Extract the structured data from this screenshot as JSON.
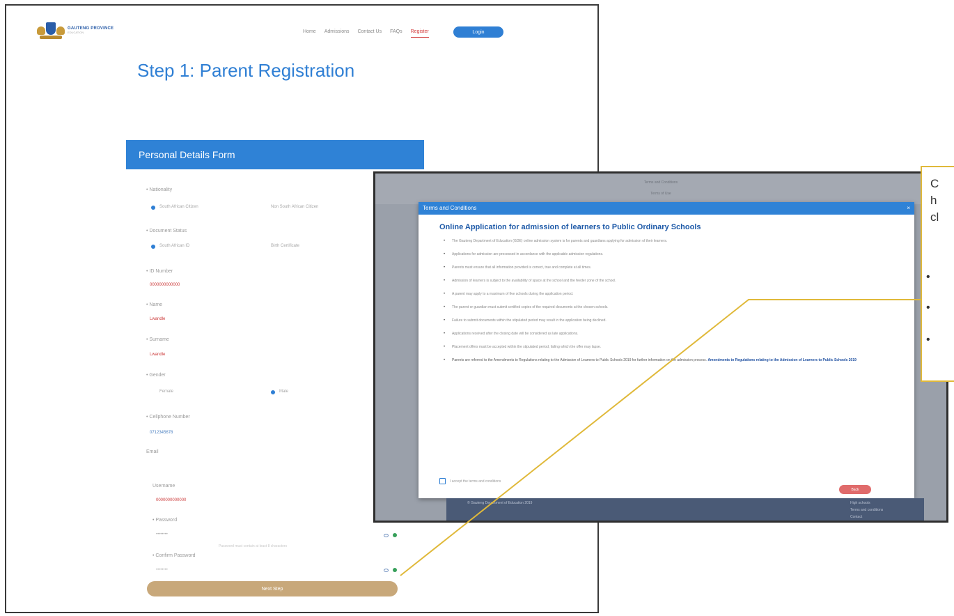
{
  "nav": {
    "brand": "GAUTENG PROVINCE",
    "brand_sub": "EDUCATION",
    "items": [
      "Home",
      "Admissions",
      "Contact Us",
      "FAQs",
      "Register"
    ],
    "login": "Login"
  },
  "page": {
    "step_prefix": "Step 1:",
    "step_title": "Parent Registration",
    "form_title": "Personal Details Form"
  },
  "form": {
    "fields": [
      {
        "label": "• Nationality",
        "value": ""
      },
      {
        "label": "• Document Status",
        "value": ""
      },
      {
        "label": "• ID Number",
        "value": "0000000000000"
      },
      {
        "label": "• Name",
        "value": "Lwandle"
      },
      {
        "label": "• Surname",
        "value": "Lwandle"
      },
      {
        "label": "• Gender",
        "value": ""
      },
      {
        "label": "• Cellphone Number",
        "value": "0712345678"
      },
      {
        "label": "Email",
        "value": ""
      },
      {
        "label": "Username",
        "value": "0000000000000"
      },
      {
        "label": "• Password",
        "value": "••••••••"
      },
      {
        "label": "• Confirm Password",
        "value": "••••••••"
      }
    ],
    "radios": {
      "nationality": [
        "South African Citizen",
        "Non South African Citizen"
      ],
      "document": [
        "South African ID",
        "Birth Certificate"
      ],
      "gender": [
        "Female",
        "Male"
      ]
    },
    "password_hint": "Password must contain at least 8 characters",
    "next": "Next Step"
  },
  "modal": {
    "top_text_1": "Terms and Conditions",
    "top_text_2": "Terms of Use",
    "header": "Terms and Conditions",
    "close": "×",
    "title": "Online Application for admission of learners to Public Ordinary Schools",
    "terms": [
      "The Gauteng Department of Education (GDE) online admission system is for parents and guardians applying for admission of their learners.",
      "Applications for admission are processed in accordance with the applicable admission regulations.",
      "Parents must ensure that all information provided is correct, true and complete at all times.",
      "Admission of learners is subject to the availability of space at the school and the feeder zone of the school.",
      "A parent may apply to a maximum of five schools during the application period.",
      "The parent or guardian must submit certified copies of the required documents at the chosen schools.",
      "Failure to submit documents within the stipulated period may result in the application being declined.",
      "Applications received after the closing date will be considered as late applications.",
      "Placement offers must be accepted within the stipulated period, failing which the offer may lapse.",
      "Parents are referred to the Amendments to Regulations relating to the Admission of Learners to Public Schools 2019 for further information on the admission process."
    ],
    "highlight": "Amendments to Regulations relating to the Admission of Learners to Public Schools 2019",
    "agree": "I accept the terms and conditions",
    "back": "Back",
    "footer_left": "© Gauteng Department of Education 2019",
    "footer_right": [
      "High schools",
      "Terms and conditions",
      "Contact"
    ]
  },
  "note": {
    "lines": [
      "C",
      "h",
      "cl"
    ],
    "bullets": [
      "•",
      "•",
      "•"
    ]
  }
}
